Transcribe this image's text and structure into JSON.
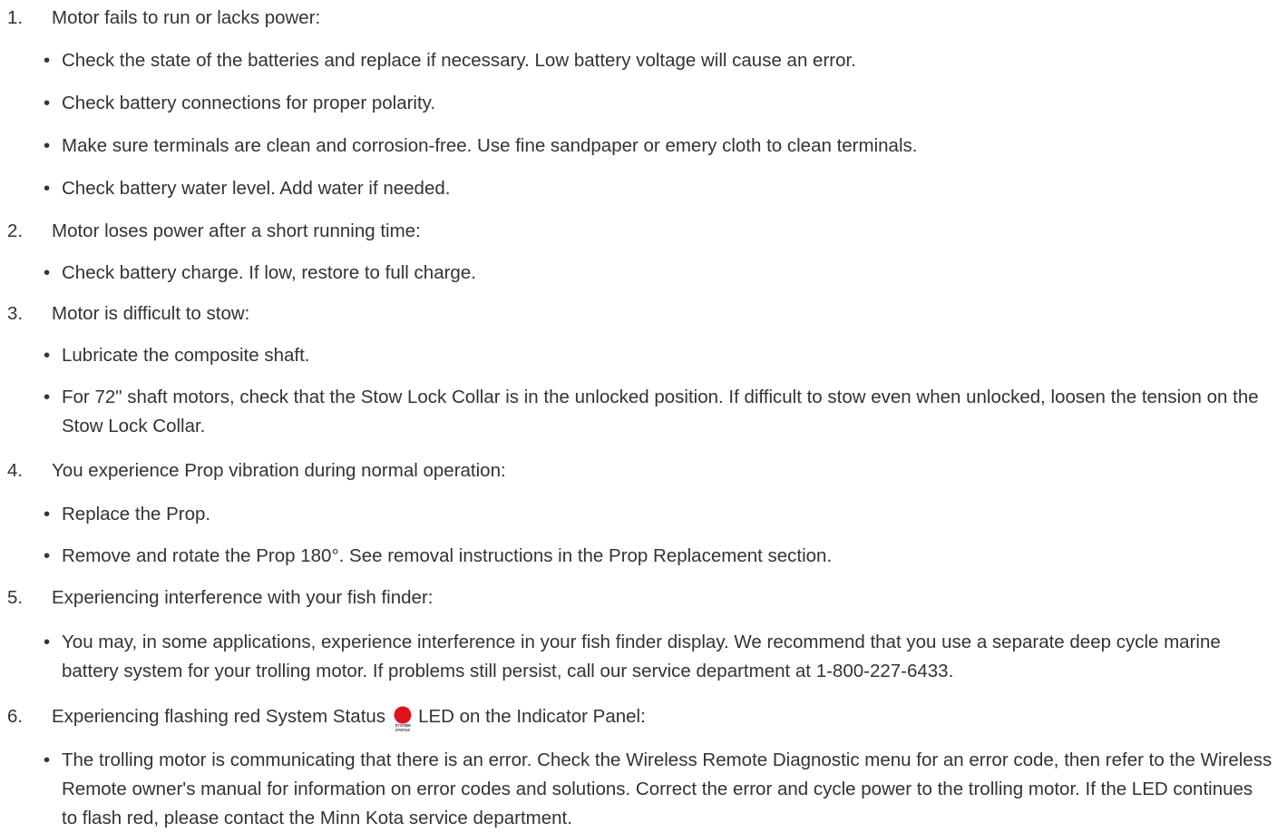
{
  "items": [
    {
      "number": "1.",
      "title": "Motor fails to run or lacks power:",
      "bullets": [
        "Check the state of the batteries and replace if necessary. Low battery voltage will cause an error.",
        "Check battery connections for proper polarity.",
        "Make sure terminals are clean and corrosion-free. Use fine sandpaper or emery cloth to clean terminals.",
        "Check battery water level. Add water if needed."
      ]
    },
    {
      "number": "2.",
      "title": "Motor loses power after a short running time:",
      "bullets": [
        "Check battery charge. If low, restore to full charge."
      ]
    },
    {
      "number": "3.",
      "title": "Motor is difficult to stow:",
      "bullets": [
        "Lubricate the composite shaft.",
        "For 72\" shaft motors, check that the Stow Lock Collar is in the unlocked position. If difficult to stow even when unlocked, loosen the tension on the Stow Lock Collar."
      ]
    },
    {
      "number": "4.",
      "title": "You experience Prop vibration during normal operation:",
      "bullets": [
        "Replace the Prop.",
        "Remove and rotate the Prop 180°. See removal instructions in the Prop Replacement section."
      ]
    },
    {
      "number": "5.",
      "title": "Experiencing interference with your fish finder:",
      "bullets": [
        "You may, in some applications, experience interference in your fish finder display. We recommend that you use a separate deep cycle marine battery system for your trolling motor. If problems still persist, call our service department at 1-800-227-6433."
      ]
    },
    {
      "number": "6.",
      "title_before": "Experiencing flashing red System Status",
      "title_after": "LED on the Indicator Panel:",
      "led_label": "SYSTEM STATUS",
      "led_color": "#e3111c",
      "bullets": [
        "The trolling motor is communicating that there is an error. Check the Wireless Remote Diagnostic menu for an error code, then refer to the Wireless Remote owner's manual for information on error codes and solutions. Correct the error and cycle power to the trolling motor. If the LED continues to flash red, please contact the Minn Kota service department."
      ]
    }
  ],
  "bullet_char": "•"
}
